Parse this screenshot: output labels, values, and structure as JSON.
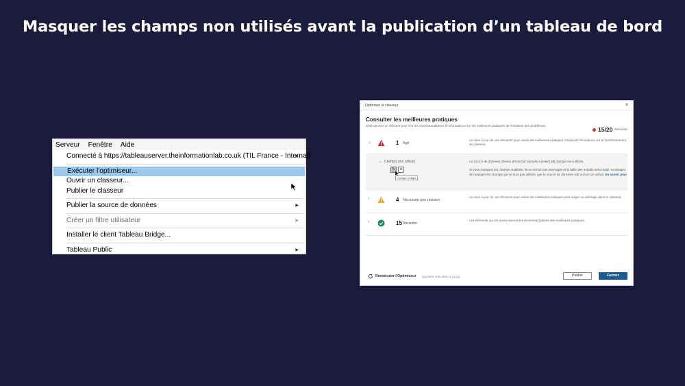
{
  "slide": {
    "title": "Masquer les champs non utilisés avant la publication d’un tableau de bord"
  },
  "menu": {
    "menubar": [
      "Serveur",
      "Fenêtre",
      "Aide"
    ],
    "connected": "Connecté à https://tableauserver.theinformationlab.co.uk (TIL France - Internal)",
    "run_optimizer": "Exécuter l'optimiseur...",
    "open_workbook": "Ouvrir un classeur...",
    "publish_workbook": "Publier le classeur",
    "publish_datasource": "Publier la source de données",
    "create_user_filter": "Créer un filtre utilisateur",
    "install_bridge": "Installer le client Tableau Bridge...",
    "tableau_public": "Tableau Public"
  },
  "dialog": {
    "window_title": "Optimiser le classeur",
    "heading": "Consulter les meilleures pratiques",
    "subheading": "Sélectionnez un élément pour voir les recommandations et informations sur les meilleures pratiques de résolution des problèmes.",
    "score": "15/20",
    "score_label": "Réussite",
    "rows": [
      {
        "count": "1",
        "label": "Agir",
        "status": "error",
        "description": "La mise à jour de ces éléments pour suivre les meilleures pratiques n'aura pas d'incidence sur le fonctionnement du classeur."
      },
      {
        "count": "4",
        "label": "Nécessite une révision",
        "status": "warning",
        "description": "La mise à jour de ces éléments pour suivre les meilleures pratiques peut exiger un arbitrage dans le classeur."
      },
      {
        "count": "15",
        "label": "Réussite",
        "status": "passed",
        "description": "Les éléments qui ont réussi suivent les recommandations des meilleures pratiques."
      }
    ],
    "sub_item": {
      "title": "Champs non utilisés",
      "desc_prefix": "La source de données",
      "datasource": "Sheet1 (Financial Sample)",
      "desc_contains": "contient",
      "unused_count": "16",
      "desc_suffix": "champs non utilisés.",
      "desc_detail": "Si vous masquez les champs inutilisés, ils ne seront pas interrogés et la taille des extraits sera réduit. Envisagez de masquer les champs qui ne sont pas utilisés, que la source de données soit ou non un extrait.",
      "learn_more": "En savoir plus",
      "tooltip": "Corriger la règle"
    },
    "footer": {
      "rerun": "Réexécuter l'Optimiseur",
      "last_run": "Dernière exécution à 14:23",
      "publish": "Publier",
      "close": "Fermer"
    }
  }
}
